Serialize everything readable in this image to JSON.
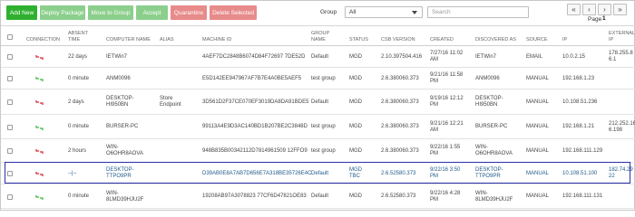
{
  "toolbar": {
    "add_new": "Add New",
    "deploy_package": "Deploy Package",
    "move_to_group": "Move to Group",
    "accept": "Accept",
    "quarantine": "Quarantine",
    "delete_selected": "Delete Selected"
  },
  "filters": {
    "group_label": "Group",
    "group_value": "All",
    "search_placeholder": "Search"
  },
  "pager": {
    "first": "«",
    "prev": "‹",
    "next": "›",
    "last": "»",
    "page_label": "Page",
    "page_number": "1"
  },
  "columns": {
    "connection": "CONNECTION",
    "absent_time": "ABSENT TIME",
    "computer_name": "COMPUTER NAME",
    "alias": "ALIAS",
    "machine_id": "MACHINE ID",
    "group_name": "GROUP NAME",
    "status": "STATUS",
    "csb_version": "CSB VERSION",
    "created": "CREATED",
    "discovered_as": "DISCOVERED AS",
    "source": "SOURCE",
    "ip": "IP",
    "external_ip": "EXTERNAL IP"
  },
  "colors": {
    "connected": "#3bb53b",
    "disconnected": "#d9232a",
    "selection": "#2a2fa8"
  },
  "rows": [
    {
      "connection": "disconnected",
      "absent": "22 days",
      "computer": "IETWin7",
      "alias": "",
      "machine_id": "4AEF7DC2848B6074D84F72697 7DE52D",
      "group": "Default",
      "status": "MGD",
      "csb": "2.10.397504.416",
      "created": [
        "7/27/16 11:02",
        "AM"
      ],
      "discovered": "IETWin7",
      "source": "EMAIL",
      "ip": "10.0.2.15",
      "ext_ip": [
        "178.255.8",
        "6.1"
      ]
    },
    {
      "connection": "connected",
      "absent": "0 minute",
      "computer": "ANM0096",
      "alias": "",
      "machine_id": "E5D142EE947967AF7B7E4A0BE5AEF5",
      "group": "test group",
      "status": "MGD",
      "csb": "2.6.380060.373",
      "created": [
        "9/21/16 11:58",
        "PM"
      ],
      "discovered": "ANM0096",
      "source": "MANUAL",
      "ip": "192.168.1.23",
      "ext_ip": [
        ""
      ]
    },
    {
      "connection": "disconnected",
      "absent": "2 days",
      "computer": "DESKTOP-HI950BN",
      "alias": "Store Endpoint",
      "machine_id": "3D561D2F37CE070EF3019DA8DA91BDE5",
      "group": "Default",
      "status": "MGD",
      "csb": "2.6.380060.373",
      "created": [
        "9/19/16 12:12",
        "PM"
      ],
      "discovered": "DESKTOP-HI950BN",
      "source": "MANUAL",
      "ip": "10.108.51.236",
      "ext_ip": [
        ""
      ]
    },
    {
      "connection": "connected",
      "absent": "0 minute",
      "computer": "BURSER-PC",
      "alias": "",
      "machine_id": "99113A4E9D3AC140BD1B207BE2C3848D",
      "group": "test group",
      "status": "MGD",
      "csb": "2.6.380060.373",
      "created": [
        "9/21/16 12:21",
        "AM"
      ],
      "discovered": "BURSER-PC",
      "source": "MANUAL",
      "ip": "192.168.1.21",
      "ext_ip": [
        "212.252.16",
        "6.198"
      ]
    },
    {
      "connection": "disconnected",
      "absent": "2 hours",
      "computer": "WIN-O6OHR8AOVA",
      "alias": "",
      "machine_id": "948B835B00342112D7814961509 12FFO9",
      "group": "test group",
      "status": "MGD",
      "csb": "2.6.380060.373",
      "created": [
        "9/22/16 1:55",
        "PM"
      ],
      "discovered": "WIN-O6OHR8AOVA",
      "source": "MANUAL",
      "ip": "192.168.111.129",
      "ext_ip": [
        ""
      ]
    },
    {
      "connection": "disconnected",
      "absent": "--|--",
      "computer": "DESKTOP-TTPO9PR",
      "alias": "",
      "machine_id": "D39AB0E8A7AB7D656E7A318BE35726E4C",
      "group": "Default",
      "status": "MGD TBC",
      "csb": "2.6.52580.373",
      "created": [
        "9/22/16 3:50",
        "PM"
      ],
      "discovered": "DESKTOP-TTPO9PR",
      "source": "MANUAL",
      "ip": "10.108.51.100",
      "ext_ip": [
        "182.74.29",
        "22"
      ]
    },
    {
      "connection": "connected",
      "absent": "0 minute",
      "computer": "WIN-8LMD39HJU2F",
      "alias": "",
      "machine_id": "19208AB97A3078823 77CF6D47821OE83",
      "group": "Default",
      "status": "MGD",
      "csb": "2.6.52580.373",
      "created": [
        "9/22/16 4:28",
        "PM"
      ],
      "discovered": "WIN-8LMD39HJU2F",
      "source": "MANUAL",
      "ip": "192.168.111.131",
      "ext_ip": [
        ""
      ]
    }
  ]
}
